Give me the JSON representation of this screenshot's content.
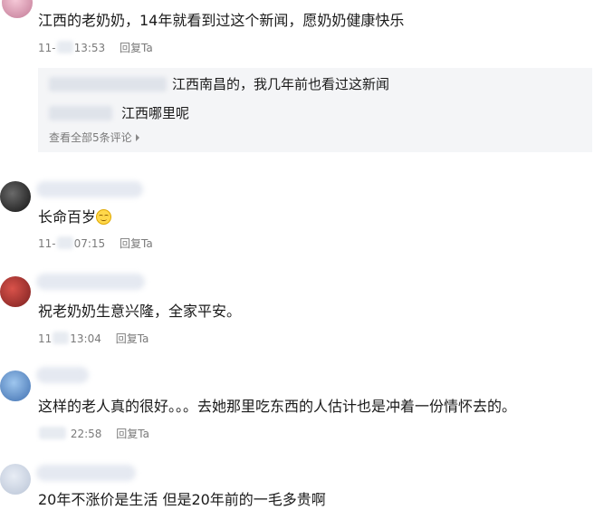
{
  "comments": [
    {
      "content": "江西的老奶奶，14年就看到过这个新闻，愿奶奶健康快乐",
      "date_prefix": "11-",
      "time": "13:53",
      "reply_label": "回复Ta",
      "replies": [
        {
          "content": "江西南昌的，我几年前也看过这新闻"
        },
        {
          "content": "江西哪里呢"
        }
      ],
      "view_all_label": "查看全部5条评论"
    },
    {
      "content": "长命百岁",
      "emoji": "relieved-face-emoji",
      "date_prefix": "11-",
      "time": "07:15",
      "reply_label": "回复Ta"
    },
    {
      "content": "祝老奶奶生意兴隆，全家平安。",
      "date_prefix": "11",
      "time": "13:04",
      "reply_label": "回复Ta"
    },
    {
      "content": "这样的老人真的很好。。。去她那里吃东西的人估计也是冲着一份情怀去的。",
      "date_prefix": "",
      "time": "22:58",
      "reply_label": "回复Ta"
    },
    {
      "content": "20年不涨价是生活 但是20年前的一毛多贵啊"
    }
  ],
  "icons": {
    "chevron": "chevron-right-icon"
  }
}
